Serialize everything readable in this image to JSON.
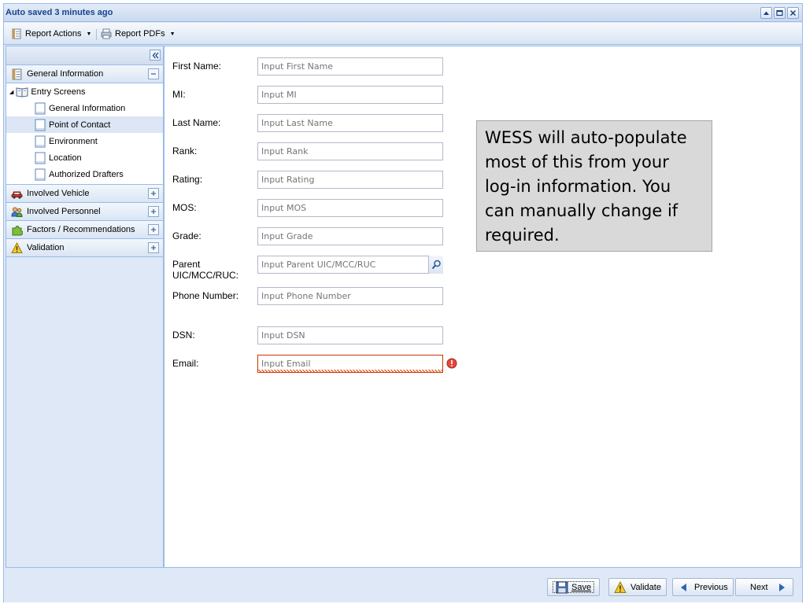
{
  "window": {
    "title": "Auto saved 3 minutes ago",
    "tool_icons": [
      "restore-icon",
      "maximize-icon",
      "close-icon"
    ]
  },
  "toolbar": {
    "report_actions_label": "Report Actions",
    "report_pdfs_label": "Report PDFs"
  },
  "sidebar": {
    "general_information": {
      "label": "General Information",
      "expanded": true,
      "tree_root": "Entry Screens",
      "items": [
        {
          "label": "General Information",
          "selected": false
        },
        {
          "label": "Point of Contact",
          "selected": true
        },
        {
          "label": "Environment",
          "selected": false
        },
        {
          "label": "Location",
          "selected": false
        },
        {
          "label": "Authorized Drafters",
          "selected": false
        }
      ]
    },
    "sections": [
      {
        "label": "Involved Vehicle",
        "icon": "vehicle-icon"
      },
      {
        "label": "Involved Personnel",
        "icon": "personnel-icon"
      },
      {
        "label": "Factors / Recommendations",
        "icon": "puzzle-icon"
      },
      {
        "label": "Validation",
        "icon": "warning-icon"
      }
    ]
  },
  "form": {
    "fields": [
      {
        "label": "First Name:",
        "placeholder": "Input First Name"
      },
      {
        "label": "MI:",
        "placeholder": "Input MI"
      },
      {
        "label": "Last Name:",
        "placeholder": "Input Last Name"
      },
      {
        "label": "Rank:",
        "placeholder": "Input Rank"
      },
      {
        "label": "Rating:",
        "placeholder": "Input Rating"
      },
      {
        "label": "MOS:",
        "placeholder": "Input MOS"
      },
      {
        "label": "Grade:",
        "placeholder": "Input Grade"
      },
      {
        "label_line1": "Parent",
        "label_line2": "UIC/MCC/RUC:",
        "placeholder": "Input Parent UIC/MCC/RUC"
      },
      {
        "label": "Phone Number:",
        "placeholder": "Input Phone Number"
      },
      {
        "label": "DSN:",
        "placeholder": "Input DSN"
      },
      {
        "label": "Email:",
        "placeholder": "Input Email",
        "invalid": true
      }
    ]
  },
  "callout": {
    "text": "WESS will auto-populate most of this from your log-in information.  You can manually change if required."
  },
  "buttons": {
    "save": "Save",
    "validate": "Validate",
    "previous": "Previous",
    "next": "Next"
  },
  "colors": {
    "panel_bg": "#dfe8f6",
    "border": "#99bbe8",
    "title_text": "#15428b",
    "selected_row": "#dce6f4",
    "error": "#cc3300",
    "callout_bg": "#d9d9d9"
  }
}
